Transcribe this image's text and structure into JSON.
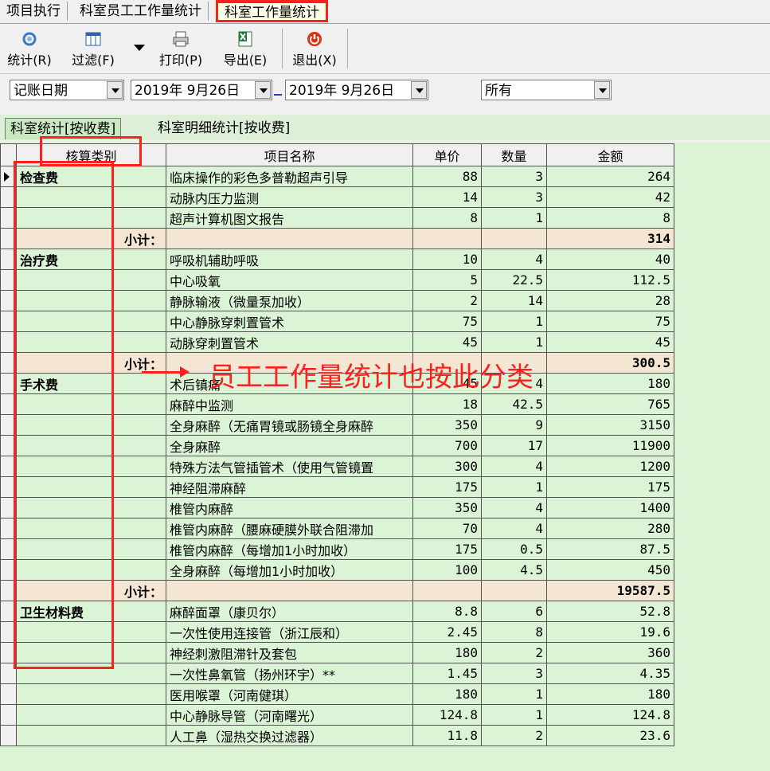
{
  "tabs": [
    "项目执行",
    "科室员工工作量统计",
    "科室工作量统计"
  ],
  "toolbar": {
    "stat_label": "统计(R)",
    "filter_label": "过滤(F)",
    "print_label": "打印(P)",
    "export_label": "导出(E)",
    "exit_label": "退出(X)"
  },
  "filters": {
    "date_type": "记账日期",
    "date_from": "2019年  9月26日",
    "date_to": "2019年  9月26日",
    "scope": "所有"
  },
  "subtabs": [
    "科室统计[按收费]",
    "科室明细统计[按收费]"
  ],
  "table": {
    "headers": [
      "核算类别",
      "项目名称",
      "单价",
      "数量",
      "金额"
    ],
    "rows": [
      {
        "cat": "检查费",
        "name": "临床操作的彩色多普勒超声引导",
        "price": "88",
        "qty": "3",
        "amount": "264"
      },
      {
        "cat": "",
        "name": "动脉内压力监测",
        "price": "14",
        "qty": "3",
        "amount": "42"
      },
      {
        "cat": "",
        "name": "超声计算机图文报告",
        "price": "8",
        "qty": "1",
        "amount": "8"
      },
      {
        "subtotal": true,
        "label": "小计：",
        "amount": "314"
      },
      {
        "cat": "治疗费",
        "name": "呼吸机辅助呼吸",
        "price": "10",
        "qty": "4",
        "amount": "40"
      },
      {
        "cat": "",
        "name": "中心吸氧",
        "price": "5",
        "qty": "22.5",
        "amount": "112.5"
      },
      {
        "cat": "",
        "name": "静脉输液（微量泵加收）",
        "price": "2",
        "qty": "14",
        "amount": "28"
      },
      {
        "cat": "",
        "name": "中心静脉穿刺置管术",
        "price": "75",
        "qty": "1",
        "amount": "75"
      },
      {
        "cat": "",
        "name": "动脉穿刺置管术",
        "price": "45",
        "qty": "1",
        "amount": "45"
      },
      {
        "subtotal": true,
        "label": "小计：",
        "amount": "300.5"
      },
      {
        "cat": "手术费",
        "name": "术后镇痛",
        "price": "45",
        "qty": "4",
        "amount": "180"
      },
      {
        "cat": "",
        "name": "麻醉中监测",
        "price": "18",
        "qty": "42.5",
        "amount": "765"
      },
      {
        "cat": "",
        "name": "全身麻醉（无痛胃镜或肠镜全身麻醉",
        "price": "350",
        "qty": "9",
        "amount": "3150"
      },
      {
        "cat": "",
        "name": "全身麻醉",
        "price": "700",
        "qty": "17",
        "amount": "11900"
      },
      {
        "cat": "",
        "name": "特殊方法气管插管术（使用气管镜置",
        "price": "300",
        "qty": "4",
        "amount": "1200"
      },
      {
        "cat": "",
        "name": "神经阻滞麻醉",
        "price": "175",
        "qty": "1",
        "amount": "175"
      },
      {
        "cat": "",
        "name": "椎管内麻醉",
        "price": "350",
        "qty": "4",
        "amount": "1400"
      },
      {
        "cat": "",
        "name": "椎管内麻醉（腰麻硬膜外联合阻滞加",
        "price": "70",
        "qty": "4",
        "amount": "280"
      },
      {
        "cat": "",
        "name": "椎管内麻醉（每增加1小时加收）",
        "price": "175",
        "qty": "0.5",
        "amount": "87.5"
      },
      {
        "cat": "",
        "name": "全身麻醉（每增加1小时加收）",
        "price": "100",
        "qty": "4.5",
        "amount": "450"
      },
      {
        "subtotal": true,
        "label": "小计：",
        "amount": "19587.5"
      },
      {
        "cat": "卫生材料费",
        "name": "麻醉面罩（康贝尔）",
        "price": "8.8",
        "qty": "6",
        "amount": "52.8"
      },
      {
        "cat": "",
        "name": "一次性使用连接管（浙江辰和）",
        "price": "2.45",
        "qty": "8",
        "amount": "19.6"
      },
      {
        "cat": "",
        "name": "神经刺激阻滞针及套包",
        "price": "180",
        "qty": "2",
        "amount": "360"
      },
      {
        "cat": "",
        "name": "一次性鼻氧管（扬州环宇）**",
        "price": "1.45",
        "qty": "3",
        "amount": "4.35"
      },
      {
        "cat": "",
        "name": "医用喉罩（河南健琪）",
        "price": "180",
        "qty": "1",
        "amount": "180"
      },
      {
        "cat": "",
        "name": "中心静脉导管（河南曙光）",
        "price": "124.8",
        "qty": "1",
        "amount": "124.8"
      },
      {
        "cat": "",
        "name": "人工鼻（湿热交换过滤器）",
        "price": "11.8",
        "qty": "2",
        "amount": "23.6"
      }
    ]
  },
  "annotation": "员工工作量统计也按此分类",
  "colors": {
    "highlight": "#ff2020",
    "grid_bg": "#dcf4d6",
    "subtotal_bg": "#f4e6d2"
  }
}
